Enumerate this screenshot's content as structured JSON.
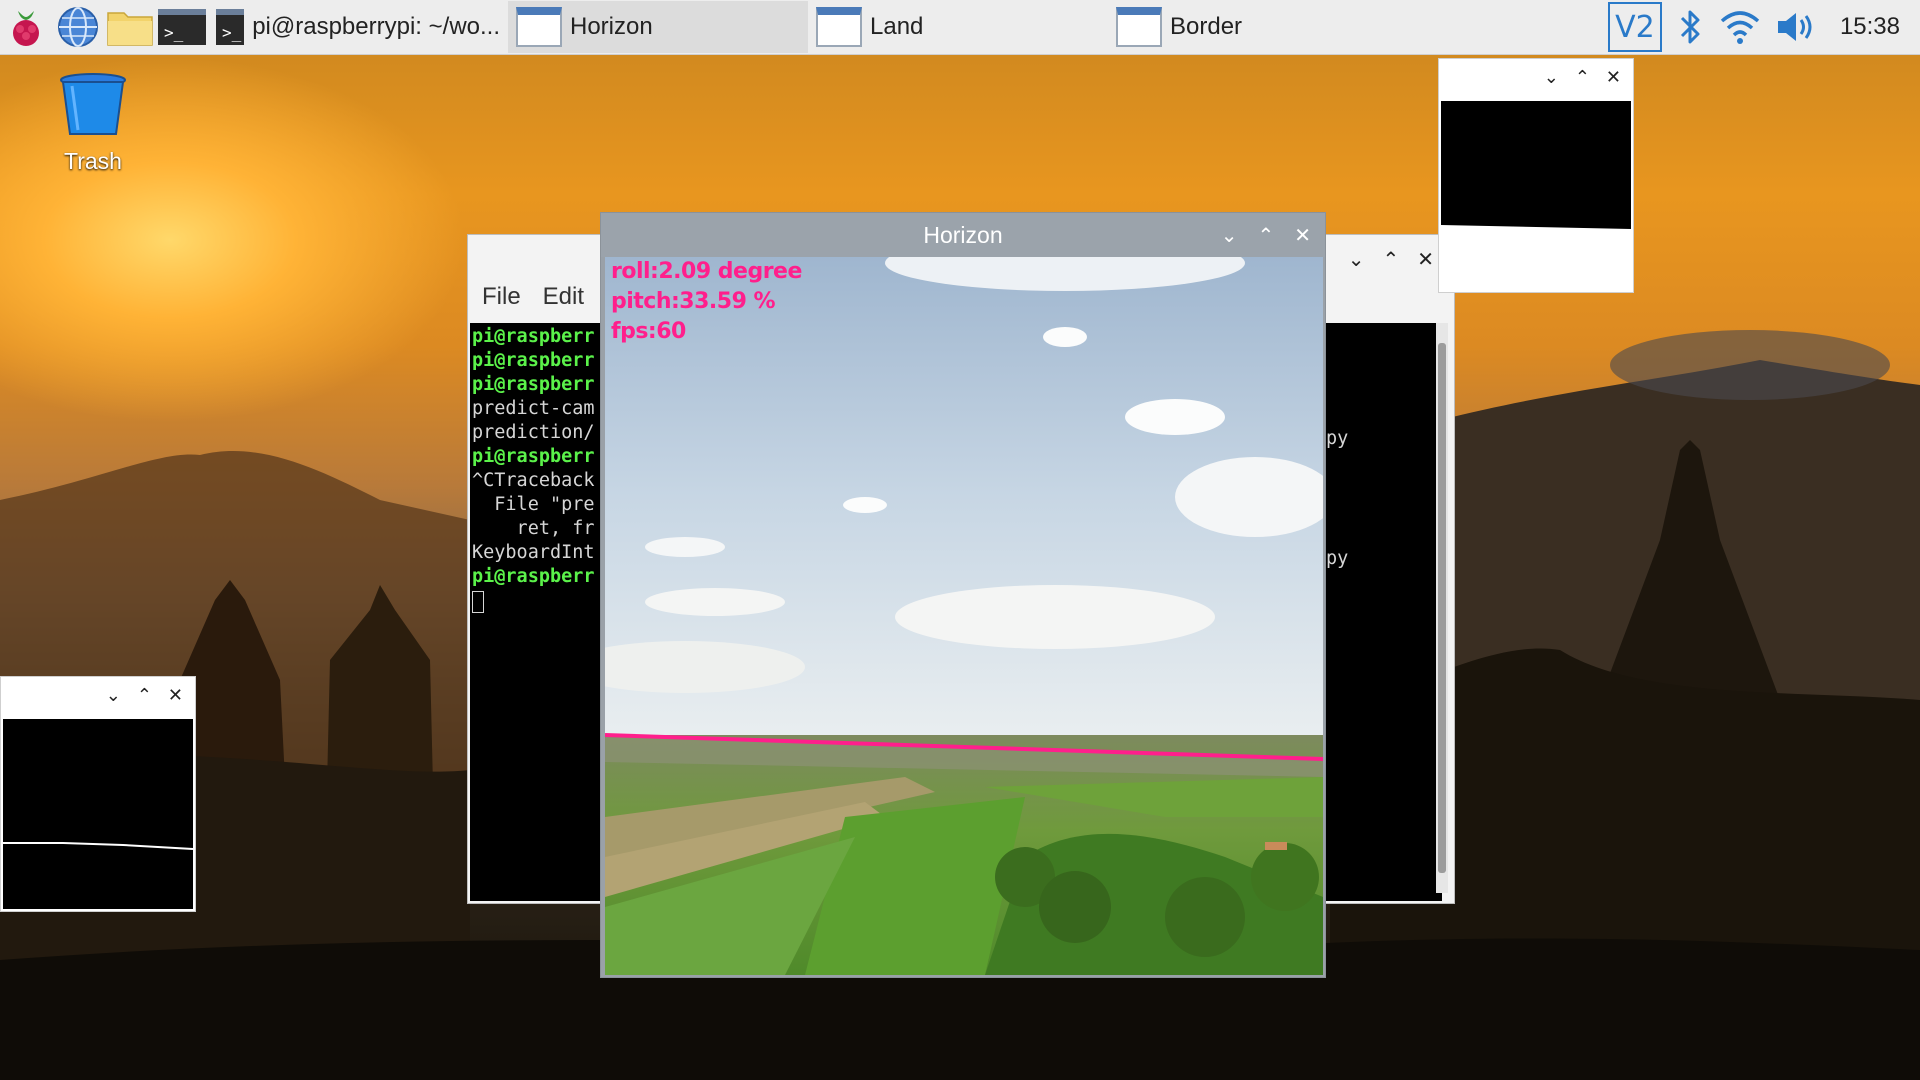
{
  "taskbar": {
    "menu_icon": "raspberry-icon",
    "browser_icon": "globe-icon",
    "files_icon": "folder-icon",
    "terminal_glyph": ">_",
    "tasks": [
      {
        "label": "pi@raspberrypi: ~/wo...",
        "icon": "terminal-icon"
      },
      {
        "label": "Horizon",
        "icon": "window-icon",
        "active": true
      },
      {
        "label": "Land",
        "icon": "window-icon"
      },
      {
        "label": "Border",
        "icon": "window-icon"
      }
    ],
    "tray": {
      "vnc_icon": "vnc-icon",
      "bluetooth_icon": "bluetooth-icon",
      "wifi_icon": "wifi-icon",
      "volume_icon": "volume-icon",
      "clock": "15:38"
    }
  },
  "desktop": {
    "trash_label": "Trash"
  },
  "terminal_window": {
    "menu": [
      "File",
      "Edit"
    ],
    "lines": [
      {
        "text": "pi@raspberr",
        "type": "prompt"
      },
      {
        "text": "pi@raspberr",
        "type": "prompt"
      },
      {
        "text": "pi@raspberr",
        "type": "prompt"
      },
      {
        "text": "predict-cam",
        "type": "output"
      },
      {
        "text": "prediction/",
        "type": "output"
      },
      {
        "text": "pi@raspberr",
        "type": "prompt"
      },
      {
        "text": "^CTraceback",
        "type": "output"
      },
      {
        "text": "  File \"pre",
        "type": "output"
      },
      {
        "text": "    ret, fr",
        "type": "output"
      },
      {
        "text": "KeyboardInt",
        "type": "output"
      },
      {
        "text": "pi@raspberr",
        "type": "prompt"
      }
    ],
    "right_fragments": [
      "py",
      "py"
    ]
  },
  "horizon_window": {
    "title": "Horizon",
    "overlay": {
      "roll": "roll:2.09 degree",
      "pitch": "pitch:33.59 %",
      "fps": "fps:60"
    },
    "horizon_line_color": "#ff1f8c"
  },
  "colors": {
    "overlay_text": "#ff1f8c",
    "prompt_green": "#5bf24a",
    "titlebar_gray": "#9ba3ab"
  }
}
